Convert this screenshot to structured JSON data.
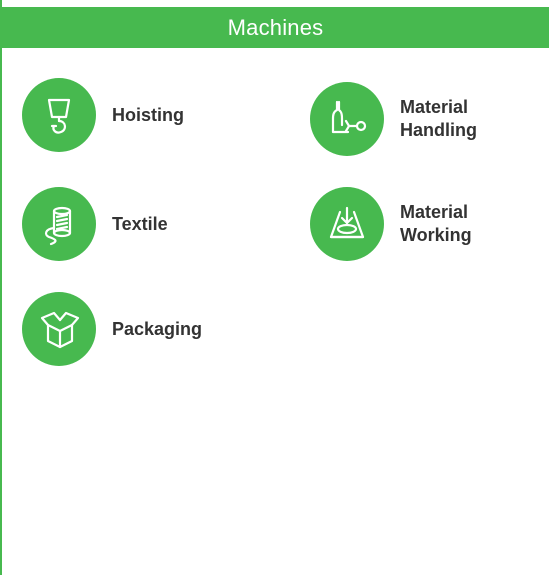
{
  "header": {
    "title": "Machines",
    "color": "#47b94f"
  },
  "items": [
    {
      "label": "Hoisting",
      "icon": "crane-hook-icon"
    },
    {
      "label": "Material Handling",
      "icon": "material-handling-icon"
    },
    {
      "label": "Textile",
      "icon": "thread-spool-icon"
    },
    {
      "label": "Material Working",
      "icon": "material-working-icon"
    },
    {
      "label": "Packaging",
      "icon": "open-box-icon"
    }
  ]
}
